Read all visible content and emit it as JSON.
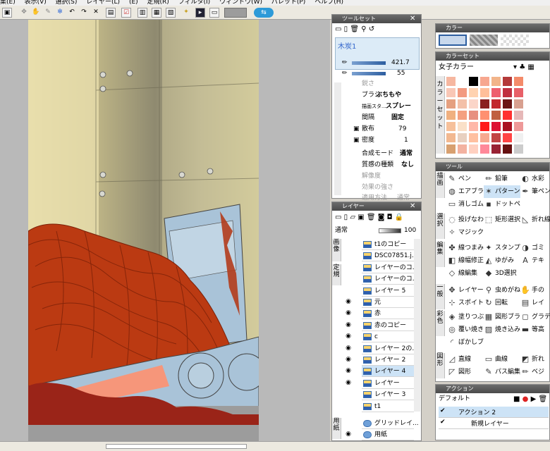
{
  "menu": [
    "集(E)",
    "表示(V)",
    "選択(S)",
    "レイヤー(L)",
    "(E)",
    "定規(R)",
    "フィルタ(I)",
    "ウィンドウ(W)",
    "パレット(P)",
    "ヘルプ(H)"
  ],
  "tool_set": {
    "title": "ツールセット",
    "tool_name": "木炭1",
    "brush_size": "421.7",
    "opacity": "55",
    "props": {
      "anti_alias": "鋭さ",
      "brush_label": "ブラシ",
      "brush_value": "ぶちもや",
      "tip_label": "描画スタ...",
      "tip_value": "スプレー",
      "interval_label": "間隔",
      "interval_value": "固定",
      "scatter_label": "散布",
      "scatter_value": "79",
      "density_label": "密度",
      "density_value": "1",
      "blend_label": "合成モード",
      "blend_value": "通常",
      "texture_label": "質感の種類",
      "texture_value": "なし",
      "resolve": "解像度",
      "effect": "効果の強さ",
      "apply": "適用方法",
      "apply_value": "通常"
    }
  },
  "color_panel": {
    "title": "カラー",
    "set_title": "カラーセット",
    "set_name": "女子カラー",
    "side_label": "カラーセット",
    "swatches": [
      "#f6b7a0",
      "#ffffff",
      "#000000",
      "#f7a78f",
      "#f2b48a",
      "#b43a3a",
      "#f48b6a",
      "#f9c7b6",
      "#f29a80",
      "#ffd2b0",
      "#ffbf9a",
      "#ee5e6e",
      "#c03040",
      "#e86068",
      "#e5a080",
      "#f3c0a8",
      "#fbd5c8",
      "#8a1f1f",
      "#c2272d",
      "#6b1414",
      "#d8a090",
      "#f0b080",
      "#f4a080",
      "#e79080",
      "#ff9070",
      "#c06040",
      "#ff3030",
      "#e6b8b8",
      "#f6c09a",
      "#fae0c8",
      "#ffb7a8",
      "#ff1a1a",
      "#dd1133",
      "#aa1122",
      "#ee9999",
      "#f2b890",
      "#e8d0c0",
      "#ffc0a0",
      "#f7a88f",
      "#c24444",
      "#ff4444",
      "#f0f0f0",
      "#d8a070",
      "#f3b2a0",
      "#ffd0c0",
      "#ff8899",
      "#992233",
      "#661111",
      "#cccccc"
    ]
  },
  "tool_panel": {
    "title": "ツール",
    "groups": [
      {
        "tab": "描画",
        "items": [
          "ペン",
          "鉛筆",
          "水彩",
          "エアブラシ",
          "パターンブラシ",
          "筆ペン",
          "消しゴム",
          "ドットペン"
        ]
      },
      {
        "tab": "選択",
        "items": [
          "投げなわ選...",
          "矩形選択",
          "折れ線",
          "マジックワンド"
        ]
      },
      {
        "tab": "編集",
        "items": [
          "線つまみ",
          "スタンプ",
          "ゴミ",
          "線幅修正",
          "ゆがみ",
          "テキ",
          "線編集",
          "3D選択"
        ]
      },
      {
        "tab": "一般",
        "items": [
          "レイヤー移動",
          "虫めがね",
          "手の",
          "スポイト",
          "回転",
          "レイ"
        ]
      },
      {
        "tab": "彩色",
        "items": [
          "塗りつぶし",
          "図形ブラシ",
          "グラデ",
          "覆い焼き",
          "焼き込み",
          "等高",
          "ぼかしブラシ"
        ]
      },
      {
        "tab": "図形",
        "items": [
          "直線",
          "曲線",
          "折れ",
          "図形",
          "パス編集",
          "ベジ"
        ]
      }
    ]
  },
  "layer_panel": {
    "title": "レイヤー",
    "blend": "通常",
    "opacity": "100",
    "side_tabs": [
      "画像",
      "定規",
      "用紙"
    ],
    "layers": [
      {
        "name": "t1のコピー",
        "visible": false,
        "selected": false
      },
      {
        "name": "DSC07851.j...",
        "visible": false,
        "selected": false
      },
      {
        "name": "レイヤーのコ...",
        "visible": false,
        "selected": false
      },
      {
        "name": "レイヤーのコ...",
        "visible": false,
        "selected": false
      },
      {
        "name": "レイヤー 5",
        "visible": false,
        "selected": false
      },
      {
        "name": "元",
        "visible": true,
        "selected": false
      },
      {
        "name": "赤",
        "visible": true,
        "selected": false
      },
      {
        "name": "赤のコピー",
        "visible": true,
        "selected": false
      },
      {
        "name": "c",
        "visible": true,
        "selected": false
      },
      {
        "name": "レイヤー 2の...",
        "visible": true,
        "selected": false
      },
      {
        "name": "レイヤー 2",
        "visible": true,
        "selected": false
      },
      {
        "name": "レイヤー 4",
        "visible": true,
        "selected": true
      },
      {
        "name": "レイヤー",
        "visible": true,
        "selected": false
      },
      {
        "name": "レイヤー 3",
        "visible": false,
        "selected": false
      },
      {
        "name": "t1",
        "visible": false,
        "selected": false
      }
    ],
    "paper_layers": [
      {
        "name": "グリッドレイ...",
        "visible": false
      },
      {
        "name": "用紙",
        "visible": true
      }
    ]
  },
  "action_panel": {
    "title": "アクション",
    "set": "デフォルト",
    "items": [
      "アクション 2",
      "新規レイヤー"
    ]
  }
}
